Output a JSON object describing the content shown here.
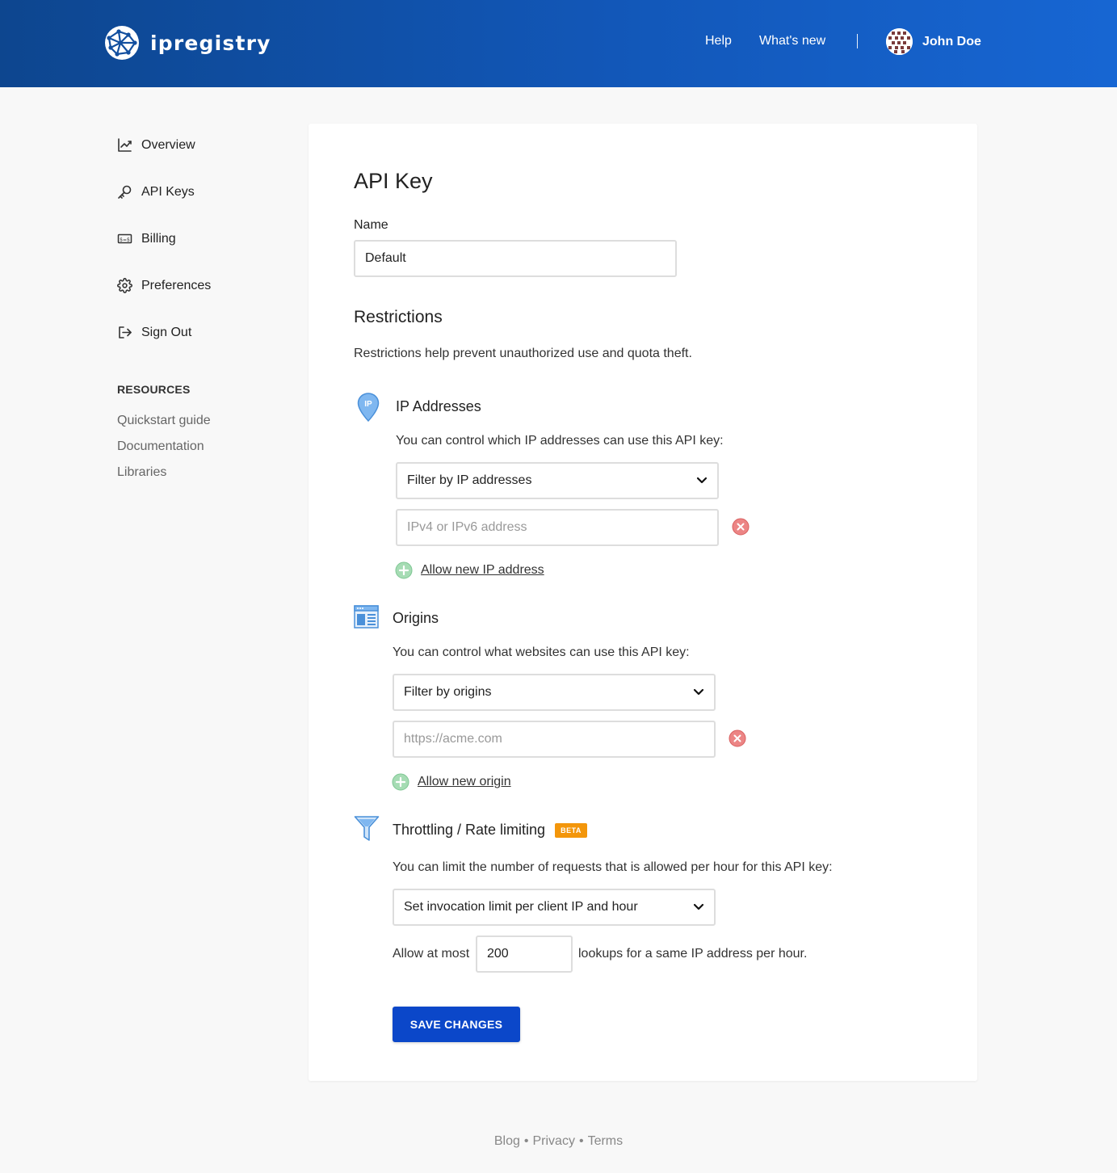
{
  "header": {
    "brand": "ipregistry",
    "nav": {
      "help": "Help",
      "whats_new": "What's new"
    },
    "user_name": "John Doe"
  },
  "sidebar": {
    "items": [
      {
        "label": "Overview",
        "icon": "chart-line-icon"
      },
      {
        "label": "API Keys",
        "icon": "key-icon"
      },
      {
        "label": "Billing",
        "icon": "billing-icon"
      },
      {
        "label": "Preferences",
        "icon": "gear-icon"
      },
      {
        "label": "Sign Out",
        "icon": "sign-out-icon"
      }
    ],
    "resources_title": "RESOURCES",
    "resources": [
      "Quickstart guide",
      "Documentation",
      "Libraries"
    ]
  },
  "main": {
    "title": "API Key",
    "name_label": "Name",
    "name_value": "Default",
    "restrictions_title": "Restrictions",
    "restrictions_desc": "Restrictions help prevent unauthorized use and quota theft.",
    "ip": {
      "title": "IP Addresses",
      "icon_text": "IP",
      "desc": "You can control which IP addresses can use this API key:",
      "select_value": "Filter by IP addresses",
      "input_placeholder": "IPv4 or IPv6 address",
      "add_label": "Allow new IP address"
    },
    "origins": {
      "title": "Origins",
      "desc": "You can control what websites can use this API key:",
      "select_value": "Filter by origins",
      "input_placeholder": "https://acme.com",
      "add_label": "Allow new origin"
    },
    "throttling": {
      "title": "Throttling / Rate limiting",
      "badge": "BETA",
      "desc": "You can limit the number of requests that is allowed per hour for this API key:",
      "select_value": "Set invocation limit per client IP and hour",
      "prefix": "Allow at most",
      "limit_value": "200",
      "suffix": "lookups for a same IP address per hour."
    },
    "save_label": "SAVE CHANGES"
  },
  "footer": {
    "links": [
      "Blog",
      "Privacy",
      "Terms"
    ],
    "separator": "•"
  },
  "colors": {
    "header_start": "#0d468f",
    "header_end": "#1766d3",
    "primary_button": "#0b47c9",
    "badge": "#f3960b",
    "remove": "#e57373",
    "add": "#81c995"
  }
}
